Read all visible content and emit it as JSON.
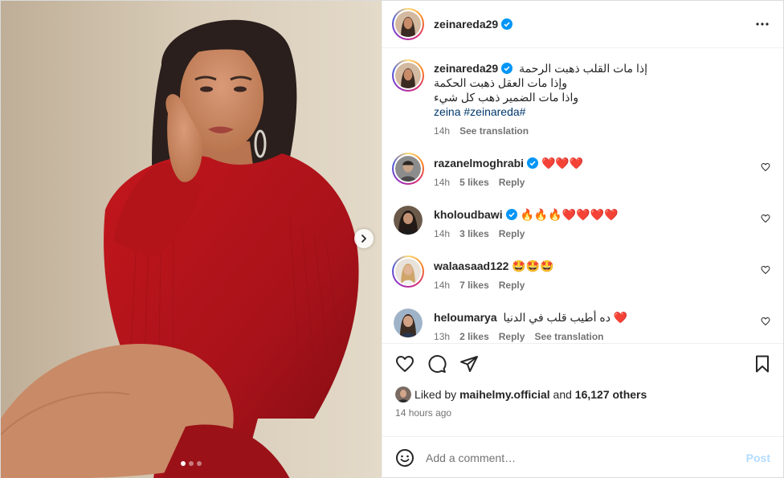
{
  "author": {
    "username": "zeinareda29",
    "verified": true
  },
  "header": {
    "more_icon": "more-horizontal-icon"
  },
  "media": {
    "slide_count": 3,
    "active_slide": 1,
    "next_icon": "chevron-right-icon"
  },
  "caption": {
    "username": "zeinareda29",
    "lines": [
      "إذا مات القلب ذهبت الرحمة",
      "وإذا مات العقل ذهبت الحكمة",
      "واذا مات الضمير ذهب كل شيء"
    ],
    "tags": "zeina #zeinareda#",
    "time": "14h",
    "see_translation": "See translation"
  },
  "comments": [
    {
      "username": "razanelmoghrabi",
      "verified": true,
      "text": "❤️❤️❤️",
      "time": "14h",
      "likes": "5 likes",
      "reply": "Reply"
    },
    {
      "username": "kholoudbawi",
      "verified": true,
      "text": "🔥🔥🔥❤️❤️❤️❤️",
      "time": "14h",
      "likes": "3 likes",
      "reply": "Reply"
    },
    {
      "username": "walaasaad122",
      "verified": false,
      "text": "🤩🤩🤩",
      "time": "14h",
      "likes": "7 likes",
      "reply": "Reply"
    },
    {
      "username": "heloumarya",
      "verified": false,
      "text": "❤️ ده أطيب قلب في الدنيا",
      "time": "13h",
      "likes": "2 likes",
      "reply": "Reply",
      "see_translation": "See translation"
    }
  ],
  "likes_line": {
    "prefix": "Liked by",
    "user": "maihelmy.official",
    "joiner": "and",
    "others": "16,127 others"
  },
  "timestamp": "14 hours ago",
  "add_comment": {
    "placeholder": "Add a comment…",
    "post_label": "Post"
  },
  "colors": {
    "accent_link": "#00376b",
    "post_button": "#b3dbff",
    "verified": "#0095f6",
    "sweater": "#b3141a"
  }
}
